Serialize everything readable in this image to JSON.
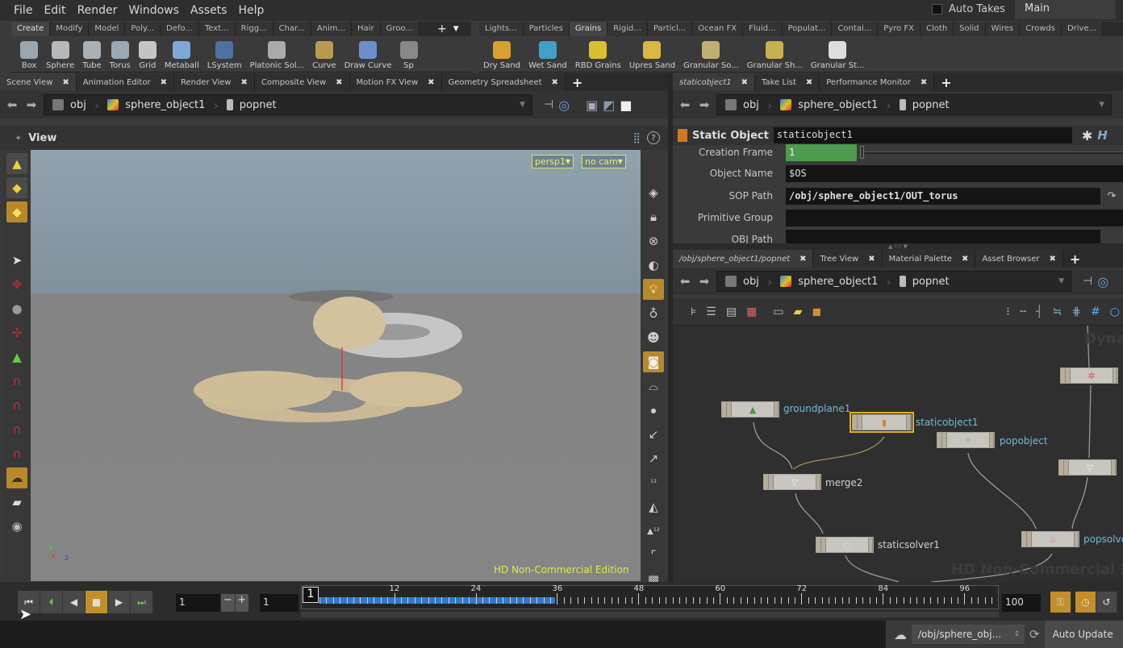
{
  "menu": [
    "File",
    "Edit",
    "Render",
    "Windows",
    "Assets",
    "Help"
  ],
  "takes": {
    "auto_takes_label": "Auto Takes",
    "auto_takes_checked": false,
    "current_take": "Main"
  },
  "shelf_left": {
    "tabs": [
      "Create",
      "Modify",
      "Model",
      "Poly...",
      "Defo...",
      "Text...",
      "Rigg...",
      "Char...",
      "Anim...",
      "Hair",
      "Groo..."
    ],
    "active_tab": "Create",
    "tools": [
      {
        "label": "Box",
        "icon": "box-icon",
        "color": "#9aa6b0"
      },
      {
        "label": "Sphere",
        "icon": "sphere-icon",
        "color": "#b5b8bc"
      },
      {
        "label": "Tube",
        "icon": "tube-icon",
        "color": "#a9b0b6"
      },
      {
        "label": "Torus",
        "icon": "torus-icon",
        "color": "#9aa9b4"
      },
      {
        "label": "Grid",
        "icon": "grid-icon",
        "color": "#c5c5c5"
      },
      {
        "label": "Metaball",
        "icon": "metaball-icon",
        "color": "#7fa8d8"
      },
      {
        "label": "LSystem",
        "icon": "lsystem-icon",
        "color": "#5070a0"
      },
      {
        "label": "Platonic Sol...",
        "icon": "platonic-icon",
        "color": "#aaa"
      },
      {
        "label": "Curve",
        "icon": "curve-icon",
        "color": "#b89a50"
      },
      {
        "label": "Draw Curve",
        "icon": "draw-curve-icon",
        "color": "#6d8fc9"
      },
      {
        "label": "Sp",
        "icon": "spray-icon",
        "color": "#888"
      }
    ]
  },
  "shelf_right": {
    "tabs": [
      "Lights...",
      "Particles",
      "Grains",
      "Rigid...",
      "Particl...",
      "Ocean FX",
      "Fluid...",
      "Populat...",
      "Contai...",
      "Pyro FX",
      "Cloth",
      "Solid",
      "Wires",
      "Crowds",
      "Drive..."
    ],
    "active_tab": "Grains",
    "tools": [
      {
        "label": "Dry Sand",
        "icon": "dry-sand-icon",
        "color": "#d8a030"
      },
      {
        "label": "Wet Sand",
        "icon": "wet-sand-icon",
        "color": "#40a0c8"
      },
      {
        "label": "RBD Grains",
        "icon": "rbd-grains-icon",
        "color": "#d8c030"
      },
      {
        "label": "Upres Sand",
        "icon": "upres-sand-icon",
        "color": "#d8b840"
      },
      {
        "label": "Granular So...",
        "icon": "granular-source-icon",
        "color": "#c0b070"
      },
      {
        "label": "Granular Sh...",
        "icon": "granular-sheet-icon",
        "color": "#c8b050"
      },
      {
        "label": "Granular St...",
        "icon": "granular-strand-icon",
        "color": "#ddd"
      }
    ]
  },
  "left_pane": {
    "tabs": [
      "Scene View",
      "Animation Editor",
      "Render View",
      "Composite View",
      "Motion FX View",
      "Geometry Spreadsheet"
    ],
    "active_tab": "Scene View",
    "path": [
      "obj",
      "sphere_object1",
      "popnet"
    ],
    "view_title": "View",
    "camera": "persp1",
    "cam_menu": "no cam",
    "watermark": "HD Non-Commercial Edition",
    "axes": {
      "y": "y",
      "x": "x",
      "z": "z"
    }
  },
  "params_pane": {
    "tabs": [
      "staticobject1",
      "Take List",
      "Performance Monitor"
    ],
    "active_tab": "staticobject1",
    "path": [
      "obj",
      "sphere_object1",
      "popnet"
    ],
    "node_type": "Static Object",
    "node_name": "staticobject1",
    "params": [
      {
        "label": "Creation Frame",
        "value": "1"
      },
      {
        "label": "Object Name",
        "value": "$OS"
      },
      {
        "label": "SOP Path",
        "value": "/obj/sphere_object1/OUT_torus"
      },
      {
        "label": "Primitive Group",
        "value": ""
      },
      {
        "label": "OBJ Path",
        "value": ""
      }
    ]
  },
  "network_pane": {
    "tabs": [
      "/obj/sphere_object1/popnet",
      "Tree View",
      "Material Palette",
      "Asset Browser"
    ],
    "active_tab": "/obj/sphere_object1/popnet",
    "path": [
      "obj",
      "sphere_object1",
      "popnet"
    ],
    "nodes": [
      {
        "name": "groundplane1",
        "selected": false
      },
      {
        "name": "staticobject1",
        "selected": true
      },
      {
        "name": "popobject",
        "selected": false
      },
      {
        "name": "merge2",
        "selected": false
      },
      {
        "name": "staticsolver1",
        "selected": false
      },
      {
        "name": "popsolver",
        "selected": false
      }
    ],
    "watermark": "HD Non-Commercial Edition",
    "context_label": "Dyna"
  },
  "playbar": {
    "current_frame": "1",
    "step": "1",
    "start_frame": "1",
    "end_frame": "100",
    "ticks": [
      "12",
      "24",
      "36",
      "48",
      "60",
      "72",
      "84",
      "96"
    ],
    "cached_fraction": 0.35
  },
  "status": {
    "path": "/obj/sphere_obj...",
    "update_mode": "Auto Update"
  }
}
